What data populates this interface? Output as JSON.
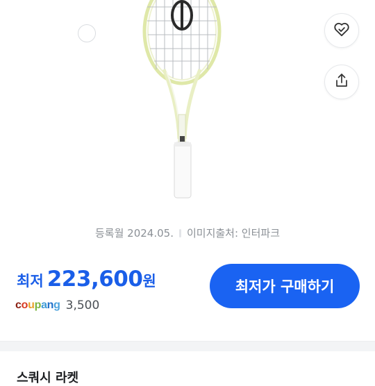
{
  "product": {
    "registered": "등록월 2024.05.",
    "image_source": "이미지출처: 인터파크"
  },
  "price": {
    "prefix": "최저",
    "value": "223,600",
    "unit": "원",
    "color": "#1a5ee8"
  },
  "seller": {
    "name": "coupang",
    "price": "3,500"
  },
  "buy_button": {
    "label": "최저가 구매하기",
    "color": "#1a63f2"
  },
  "icons": {
    "wish": "heart-check-icon",
    "share": "share-icon"
  },
  "next_section": {
    "title": "스쿼시 라켓"
  }
}
